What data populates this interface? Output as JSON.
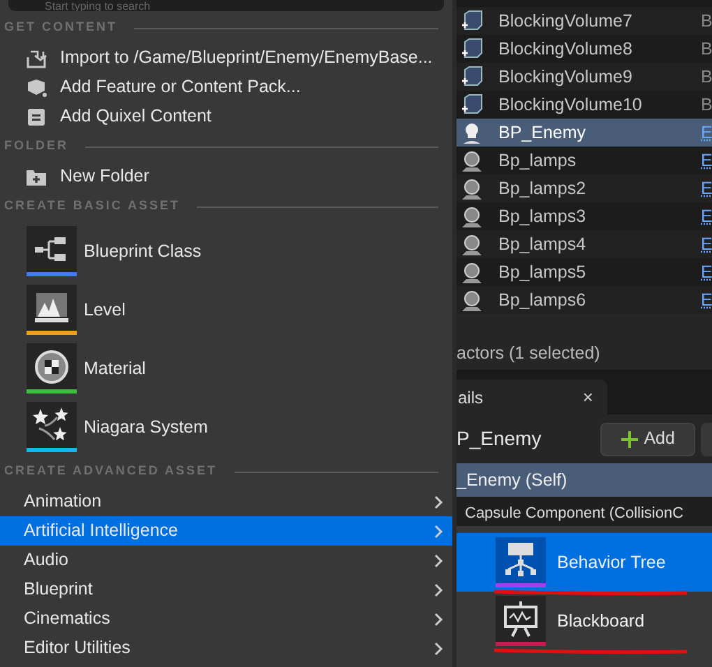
{
  "menu": {
    "search": {
      "placeholder": "Start typing to search"
    },
    "sections": [
      {
        "title": "GET CONTENT",
        "kind": "actions",
        "items": [
          {
            "label": "Import to /Game/Blueprint/Enemy/EnemyBase...",
            "kind": "import"
          },
          {
            "label": "Add Feature or Content Pack...",
            "kind": "pack"
          },
          {
            "label": "Add Quixel Content",
            "kind": "quixel"
          }
        ]
      },
      {
        "title": "FOLDER",
        "kind": "actions",
        "items": [
          {
            "label": "New Folder",
            "kind": "folder"
          }
        ]
      },
      {
        "title": "CREATE BASIC ASSET",
        "kind": "assets",
        "items": [
          {
            "label": "Blueprint Class",
            "kind": "blueprint",
            "color": "#3f7cf0"
          },
          {
            "label": "Level",
            "kind": "level",
            "color": "#f0a010"
          },
          {
            "label": "Material",
            "kind": "material",
            "color": "#3cbf3c"
          },
          {
            "label": "Niagara System",
            "kind": "niagara",
            "color": "#10b8f0"
          }
        ]
      },
      {
        "title": "CREATE ADVANCED ASSET",
        "kind": "categories",
        "items": [
          {
            "label": "Animation",
            "selected": false
          },
          {
            "label": "Artificial Intelligence",
            "selected": true
          },
          {
            "label": "Audio",
            "selected": false
          },
          {
            "label": "Blueprint",
            "selected": false
          },
          {
            "label": "Cinematics",
            "selected": false
          },
          {
            "label": "Editor Utilities",
            "selected": false
          }
        ]
      }
    ]
  },
  "outliner": {
    "rows": [
      {
        "name": "BlockingVolume7",
        "column_2": "B",
        "kind": "volume",
        "selected": false
      },
      {
        "name": "BlockingVolume8",
        "column_2": "B",
        "kind": "volume",
        "selected": false
      },
      {
        "name": "BlockingVolume9",
        "column_2": "B",
        "kind": "volume",
        "selected": false
      },
      {
        "name": "BlockingVolume10",
        "column_2": "B",
        "kind": "volume",
        "selected": false
      },
      {
        "name": "BP_Enemy",
        "column_2": "E",
        "kind": "enemy",
        "selected": true
      },
      {
        "name": "Bp_lamps",
        "column_2": "E",
        "kind": "lamp",
        "selected": false
      },
      {
        "name": "Bp_lamps2",
        "column_2": "E",
        "kind": "lamp",
        "selected": false
      },
      {
        "name": "Bp_lamps3",
        "column_2": "E",
        "kind": "lamp",
        "selected": false
      },
      {
        "name": "Bp_lamps4",
        "column_2": "E",
        "kind": "lamp",
        "selected": false
      },
      {
        "name": "Bp_lamps5",
        "column_2": "E",
        "kind": "lamp",
        "selected": false
      },
      {
        "name": "Bp_lamps6",
        "column_2": "E",
        "kind": "lamp",
        "selected": false
      }
    ],
    "status": "actors (1 selected)"
  },
  "details": {
    "tab": "ails",
    "close": "×",
    "title": "P_Enemy",
    "add_button": "Add",
    "components": [
      {
        "label": "_Enemy (Self)",
        "selected": true
      },
      {
        "label": "Capsule Component (CollisionC",
        "selected": false
      }
    ]
  },
  "submenu": {
    "items": [
      {
        "label": "Behavior Tree",
        "kind": "tree",
        "color": "#a040f0",
        "selected": true,
        "underlined": true
      },
      {
        "label": "Blackboard",
        "kind": "board",
        "color": "#c02050",
        "selected": false,
        "underlined": true
      }
    ]
  }
}
